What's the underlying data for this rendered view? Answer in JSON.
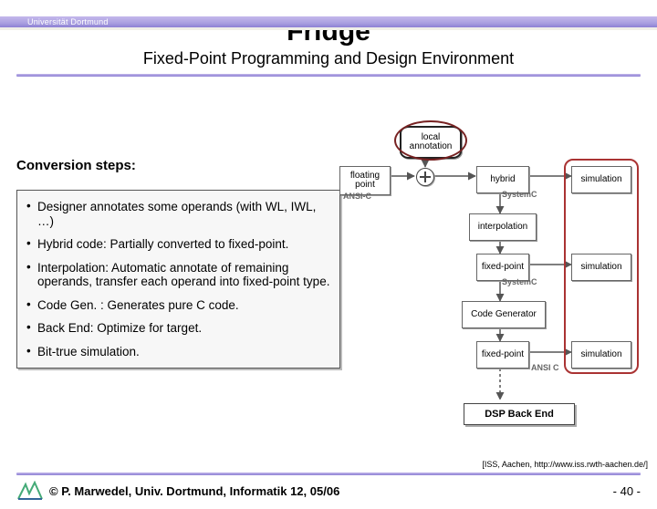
{
  "header": {
    "institution": "Universität Dortmund"
  },
  "title": "Fridge",
  "subtitle": "Fixed-Point Programming and Design Environment",
  "section_heading": "Conversion steps:",
  "bullets": [
    "Designer annotates some operands (with WL, IWL, …)",
    "Hybrid code: Partially converted to fixed-point.",
    "Interpolation: Automatic annotate of remaining operands,  transfer each operand into fixed-point type.",
    "Code Gen. : Generates pure C code.",
    "Back End: Optimize for target.",
    "Bit-true simulation."
  ],
  "diagram": {
    "annot": "local annotation",
    "box_float": "floating point",
    "box_hybrid": "hybrid",
    "box_interp": "interpolation",
    "box_fixed1": "fixed-point",
    "box_fixed2": "fixed-point",
    "box_codegen": "Code Generator",
    "sim": "simulation",
    "lang_ansi": "ANSI-C",
    "lang_sysc": "SystemC",
    "lang_ansic2": "ANSI C"
  },
  "dsp": "DSP Back End",
  "credit": "[ISS, Aachen, http://www.iss.rwth-aachen.de/]",
  "footer": {
    "copyright": "© P. Marwedel, Univ. Dortmund, Informatik 12, 05/06",
    "page": "-  40  -"
  }
}
